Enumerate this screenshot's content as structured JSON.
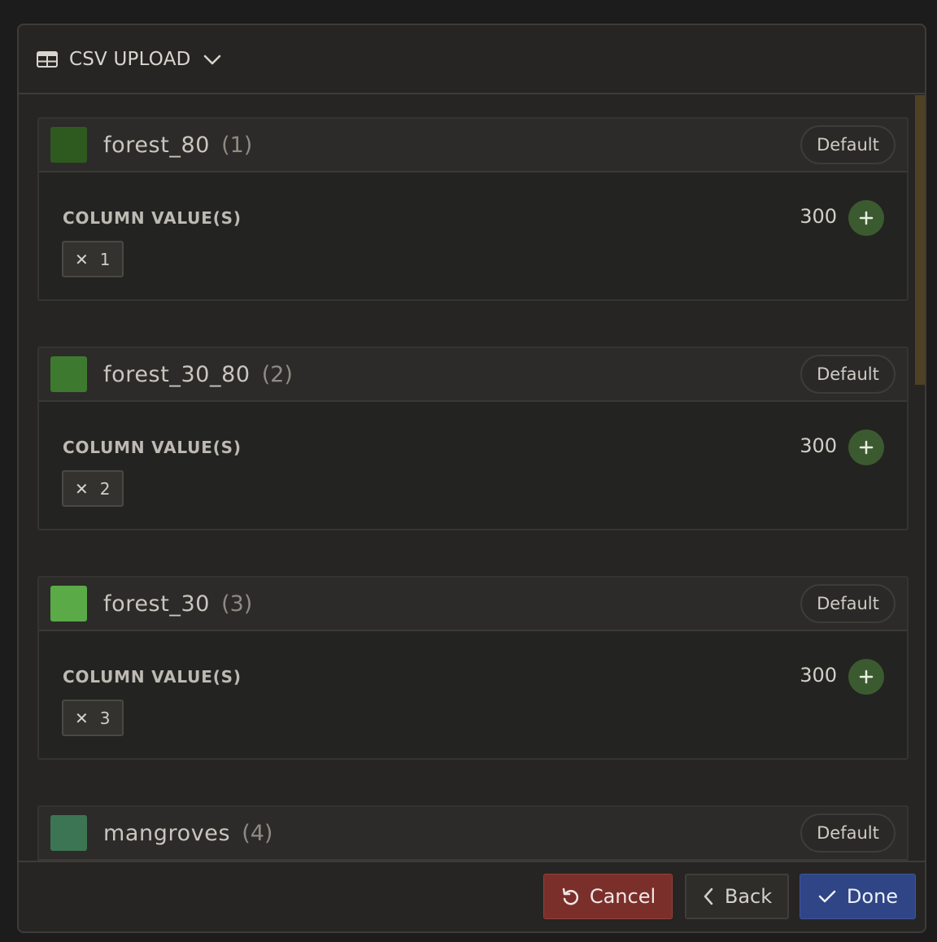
{
  "header": {
    "title": "CSV UPLOAD",
    "icon": "table-icon",
    "toggle_icon": "chevron-down-icon"
  },
  "cards": [
    {
      "name": "forest_80",
      "count": "(1)",
      "color": "#2e5a1f",
      "default_label": "Default",
      "column_label": "COLUMN VALUE(S)",
      "value": "300",
      "chip": "1"
    },
    {
      "name": "forest_30_80",
      "count": "(2)",
      "color": "#3d7a2f",
      "default_label": "Default",
      "column_label": "COLUMN VALUE(S)",
      "value": "300",
      "chip": "2"
    },
    {
      "name": "forest_30",
      "count": "(3)",
      "color": "#5aab47",
      "default_label": "Default",
      "column_label": "COLUMN VALUE(S)",
      "value": "300",
      "chip": "3"
    },
    {
      "name": "mangroves",
      "count": "(4)",
      "color": "#3c7553",
      "default_label": "Default"
    }
  ],
  "footer": {
    "cancel_label": "Cancel",
    "back_label": "Back",
    "done_label": "Done"
  },
  "colors": {
    "cancel": "#7a2f2b",
    "done": "#2f4585",
    "add": "#3c5a30",
    "scroll_thumb": "#4f4123"
  }
}
